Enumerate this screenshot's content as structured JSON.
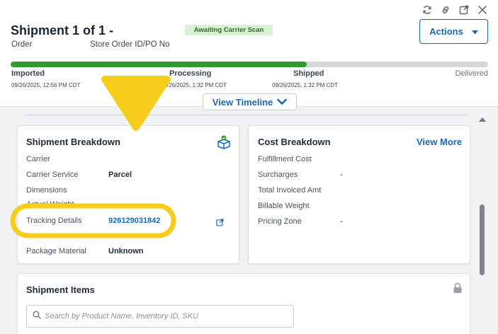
{
  "header": {
    "title": "Shipment 1 of 1 -",
    "status_badge": "Awaiting Carrier Scan",
    "order_label": "Order",
    "po_label": "Store Order ID/PO No",
    "actions_label": "Actions",
    "icons": [
      "refresh-icon",
      "link-icon",
      "external-open-icon",
      "close-icon"
    ]
  },
  "progress": {
    "fraction": 0.62,
    "stages": [
      {
        "name": "Imported",
        "date": "09/26/2025, 12:56 PM CDT"
      },
      {
        "name": "Processing",
        "date": "09/26/2025, 1:32 PM CDT"
      },
      {
        "name": "Shipped",
        "date": "09/26/2025, 1:32 PM CDT"
      },
      {
        "name": "Delivered",
        "date": ""
      }
    ],
    "timeline_label": "View Timeline"
  },
  "shipment_breakdown": {
    "title": "Shipment Breakdown",
    "rows": [
      {
        "label": "Carrier",
        "value": ""
      },
      {
        "label": "Carrier Service",
        "value": "Parcel"
      },
      {
        "label": "Dimensions",
        "value": ""
      },
      {
        "label": "Actual Weight",
        "value": ""
      },
      {
        "label": "Tracking Details",
        "value": "926129031842"
      },
      {
        "label": "Package Material",
        "value": "Unknown"
      }
    ]
  },
  "cost_breakdown": {
    "title": "Cost Breakdown",
    "view_more": "View More",
    "rows": [
      {
        "label": "Fulfillment Cost",
        "value": ""
      },
      {
        "label": "Surcharges",
        "value": "-"
      },
      {
        "label": "Total Invoiced Amt",
        "value": ""
      },
      {
        "label": "Billable Weight",
        "value": ""
      },
      {
        "label": "Pricing Zone",
        "value": "-"
      }
    ]
  },
  "shipment_items": {
    "title": "Shipment Items",
    "search_placeholder": "Search by Product Name, Inventory ID, SKU"
  },
  "colors": {
    "accent": "#1b67b5",
    "progress": "#2f9d2c",
    "badge_bg": "#d9efd6",
    "annotation": "#f7cc1b"
  }
}
